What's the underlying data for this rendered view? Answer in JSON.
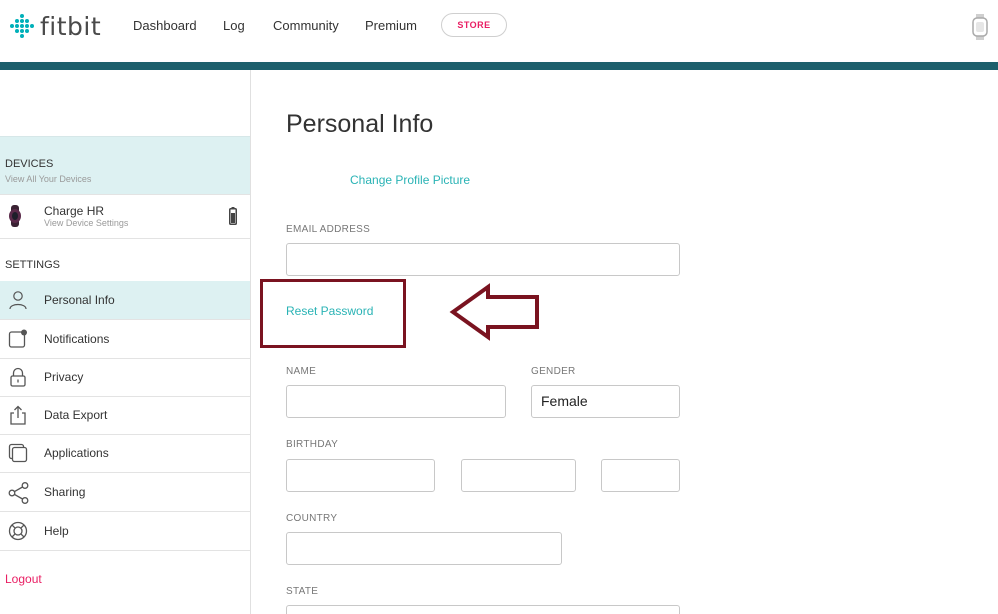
{
  "brand": {
    "name": "fitbit"
  },
  "nav": {
    "links": [
      "Dashboard",
      "Log",
      "Community",
      "Premium"
    ],
    "store_label": "STORE"
  },
  "sidebar": {
    "devices": {
      "title": "DEVICES",
      "subtitle": "View All Your Devices"
    },
    "device": {
      "name": "Charge HR",
      "subtitle": "View Device Settings"
    },
    "settings_title": "SETTINGS",
    "items": [
      {
        "label": "Personal Info",
        "icon": "person-icon",
        "active": true
      },
      {
        "label": "Notifications",
        "icon": "notification-icon",
        "active": false
      },
      {
        "label": "Privacy",
        "icon": "lock-icon",
        "active": false
      },
      {
        "label": "Data Export",
        "icon": "export-icon",
        "active": false
      },
      {
        "label": "Applications",
        "icon": "applications-icon",
        "active": false
      },
      {
        "label": "Sharing",
        "icon": "share-icon",
        "active": false
      },
      {
        "label": "Help",
        "icon": "help-icon",
        "active": false
      }
    ],
    "logout_label": "Logout"
  },
  "main": {
    "title": "Personal Info",
    "change_picture_label": "Change Profile Picture",
    "email_label": "EMAIL ADDRESS",
    "email_value": "",
    "reset_password_label": "Reset Password",
    "name_label": "NAME",
    "name_value": "",
    "gender_label": "GENDER",
    "gender_value": "Female",
    "birthday_label": "BIRTHDAY",
    "country_label": "COUNTRY",
    "country_value": "",
    "state_label": "STATE"
  },
  "colors": {
    "accent": "#00B0B9",
    "link": "#2ab3b5",
    "header_bar": "#1d5f6c",
    "active_bg": "#ddf1f2",
    "logout": "#e91e63",
    "annotation": "#7a1320"
  }
}
